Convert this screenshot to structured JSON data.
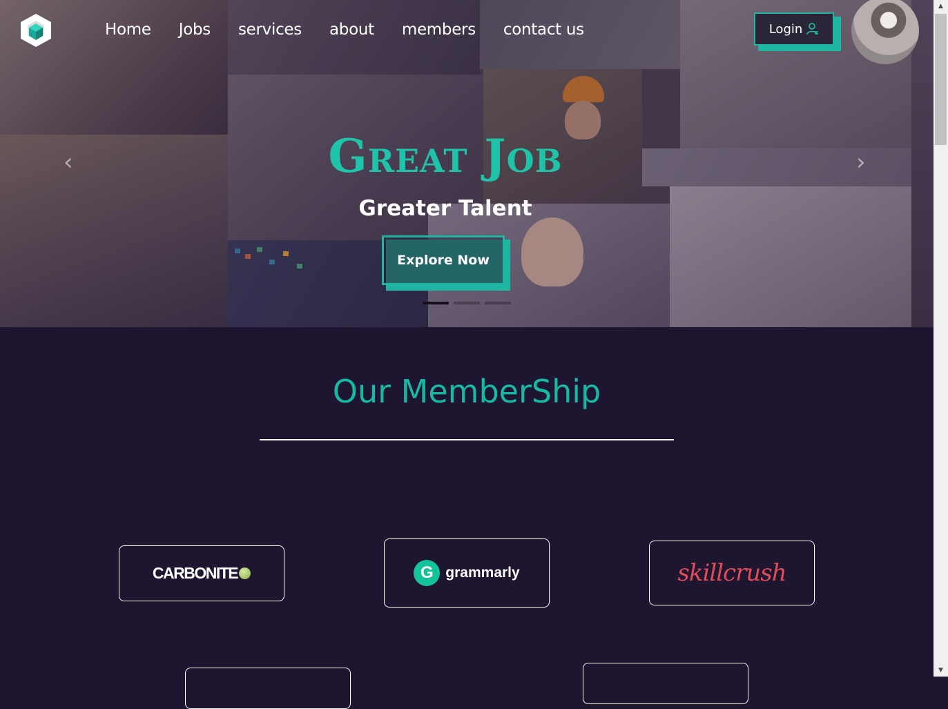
{
  "nav": {
    "items": [
      "Home",
      "Jobs",
      "services",
      "about",
      "members",
      "contact us"
    ],
    "login_label": "Login"
  },
  "hero": {
    "title": "Great Job",
    "subtitle": "Greater Talent",
    "cta": "Explore Now",
    "slides": 3,
    "active_slide": 1
  },
  "membership": {
    "title": "Our MemberShip",
    "partners": [
      {
        "name": "CARBONITE"
      },
      {
        "name": "grammarly"
      },
      {
        "name": "skillcrush"
      }
    ]
  },
  "colors": {
    "accent": "#1fb5a3",
    "background": "#1e1530",
    "skillcrush": "#e24b57",
    "grammarly": "#15c39a"
  }
}
